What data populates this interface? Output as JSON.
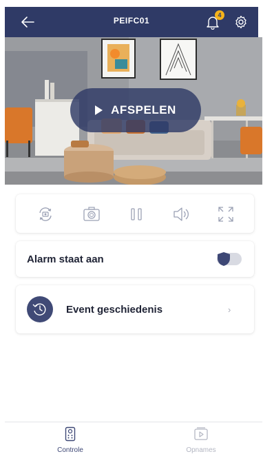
{
  "header": {
    "title": "PEIFC01",
    "notification_count": "4",
    "background": "#2f3a66",
    "badge_color": "#f4b21b"
  },
  "video": {
    "play_label": "AFSPELEN"
  },
  "controls": {
    "items": [
      "rotate-camera-icon",
      "snapshot-camera-icon",
      "pause-icon",
      "speaker-icon",
      "fullscreen-icon"
    ]
  },
  "alarm": {
    "label": "Alarm staat aan",
    "enabled": true
  },
  "event": {
    "label": "Event geschiedenis"
  },
  "bottom_nav": {
    "items": [
      {
        "label": "Controle",
        "icon": "remote-control-icon",
        "active": true
      },
      {
        "label": "Opnames",
        "icon": "recordings-icon",
        "active": false
      }
    ]
  }
}
